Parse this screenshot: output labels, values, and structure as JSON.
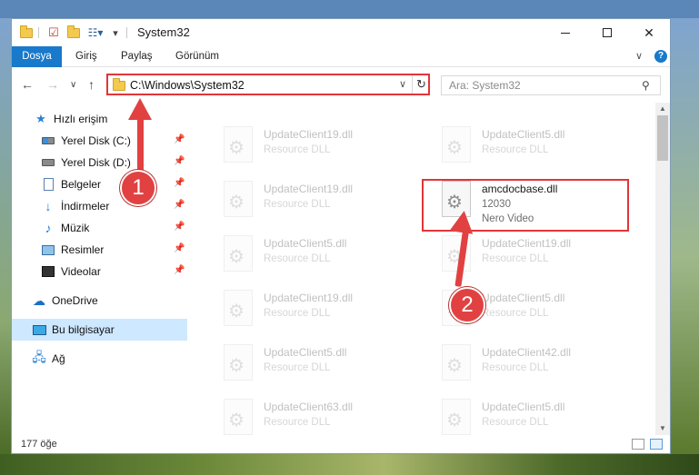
{
  "window": {
    "title": "System32",
    "controls": {
      "minimize": "—",
      "maximize": "☐",
      "close": "✕"
    }
  },
  "ribbon": {
    "tabs": [
      "Dosya",
      "Giriş",
      "Paylaş",
      "Görünüm"
    ],
    "help": "?"
  },
  "address": {
    "path": "C:\\Windows\\System32",
    "search_placeholder": "Ara: System32"
  },
  "sidebar": {
    "items": [
      {
        "label": "Hızlı erişim",
        "icon": "star-icon"
      },
      {
        "label": "Yerel Disk (C:)",
        "icon": "drive-icon",
        "pinned": true
      },
      {
        "label": "Yerel Disk (D:)",
        "icon": "drive-icon",
        "pinned": true
      },
      {
        "label": "Belgeler",
        "icon": "documents-icon",
        "pinned": true
      },
      {
        "label": "İndirmeler",
        "icon": "download-icon",
        "pinned": true
      },
      {
        "label": "Müzik",
        "icon": "music-icon",
        "pinned": true
      },
      {
        "label": "Resimler",
        "icon": "pictures-icon",
        "pinned": true
      },
      {
        "label": "Videolar",
        "icon": "videos-icon",
        "pinned": true
      },
      {
        "label": "OneDrive",
        "icon": "cloud-icon"
      },
      {
        "label": "Bu bilgisayar",
        "icon": "computer-icon",
        "selected": true
      },
      {
        "label": "Ağ",
        "icon": "network-icon"
      }
    ]
  },
  "files": [
    {
      "name": "UpdateClient19.dll",
      "desc": "Resource DLL"
    },
    {
      "name": "UpdateClient5.dll",
      "desc": "Resource DLL"
    },
    {
      "name": "UpdateClient19.dll",
      "desc": "Resource DLL"
    },
    {
      "name": "amcdocbase.dll",
      "desc": "12030",
      "extra": "Nero Video"
    },
    {
      "name": "UpdateClient5.dll",
      "desc": "Resource DLL"
    },
    {
      "name": "UpdateClient19.dll",
      "desc": "Resource DLL"
    },
    {
      "name": "UpdateClient19.dll",
      "desc": "Resource DLL"
    },
    {
      "name": "UpdateClient5.dll",
      "desc": "Resource DLL"
    },
    {
      "name": "UpdateClient5.dll",
      "desc": "Resource DLL"
    },
    {
      "name": "UpdateClient42.dll",
      "desc": "Resource DLL"
    },
    {
      "name": "UpdateClient63.dll",
      "desc": "Resource DLL"
    },
    {
      "name": "UpdateClient5.dll",
      "desc": "Resource DLL"
    }
  ],
  "status": {
    "count": "177 öğe"
  },
  "annotations": {
    "badge1": "1",
    "badge2": "2",
    "color": "#e14141"
  }
}
